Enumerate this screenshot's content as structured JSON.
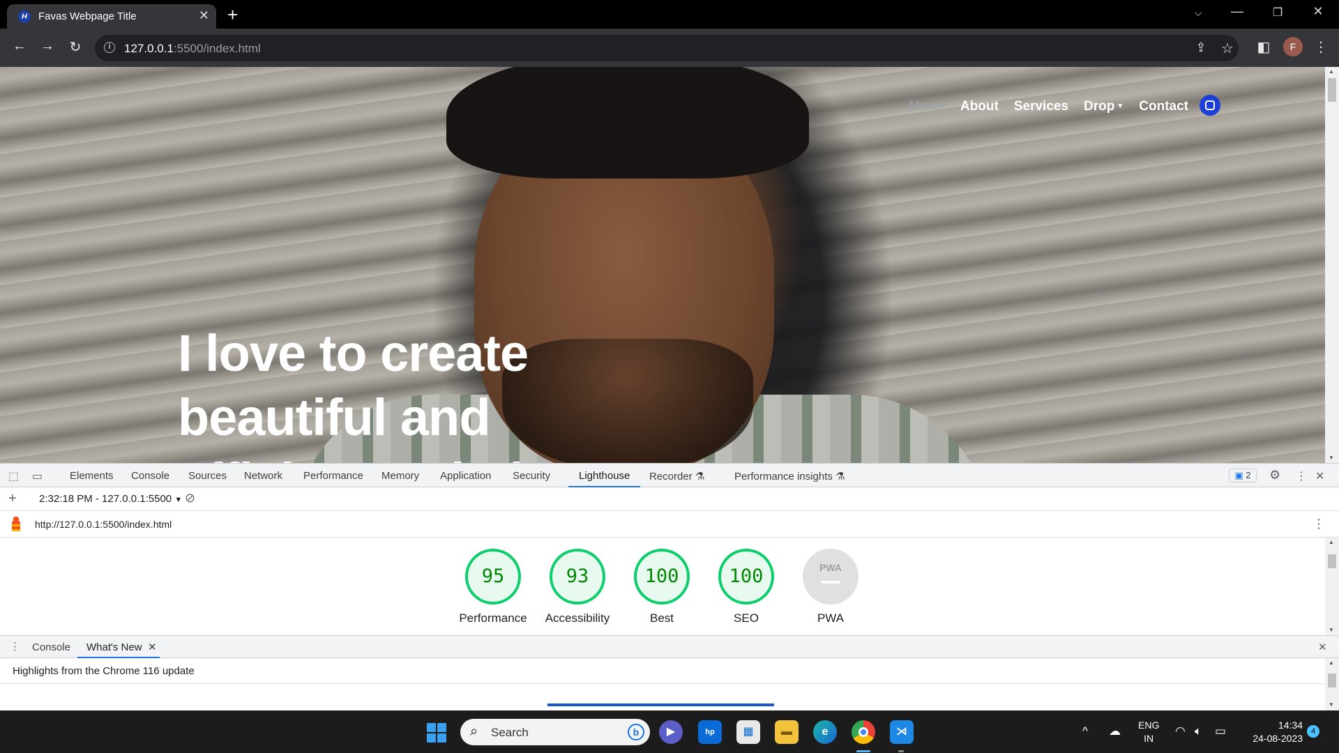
{
  "browser": {
    "tab_title": "Favas Webpage Title",
    "tab_favicon": "H",
    "url_host": "127.0.0.1",
    "url_path": ":5500/index.html",
    "profile_initial": "F"
  },
  "site": {
    "nav": {
      "home": "Home",
      "about": "About",
      "services": "Services",
      "drop": "Drop",
      "contact": "Contact"
    },
    "hero_line1": "I love to create",
    "hero_line2": "beautiful and",
    "hero_line3": "efficient websites"
  },
  "devtools": {
    "tabs": [
      "Elements",
      "Console",
      "Sources",
      "Network",
      "Performance",
      "Memory",
      "Application",
      "Security",
      "Lighthouse",
      "Recorder",
      "Performance insights"
    ],
    "active_tab": "Lighthouse",
    "issues_count": "2",
    "report_selector": "2:32:18 PM - 127.0.0.1:5500",
    "report_url": "http://127.0.0.1:5500/index.html",
    "scores": [
      {
        "value": "95",
        "label": "Performance"
      },
      {
        "value": "93",
        "label": "Accessibility"
      },
      {
        "value": "100",
        "label": "Best"
      },
      {
        "value": "100",
        "label": "SEO"
      }
    ],
    "pwa": {
      "badge": "PWA",
      "label": "PWA"
    },
    "drawer_tabs": {
      "console": "Console",
      "whats_new": "What's New"
    },
    "drawer_text": "Highlights from the Chrome 116 update"
  },
  "taskbar": {
    "search_placeholder": "Search",
    "lang_line1": "ENG",
    "lang_line2": "IN",
    "time": "14:34",
    "date": "24-08-2023",
    "notifications": "4"
  },
  "colors": {
    "score_green": "#0cce6b",
    "score_bg": "#e8f9ef",
    "devtools_accent": "#1a73e8",
    "instagram_button": "#1c3fd6"
  }
}
